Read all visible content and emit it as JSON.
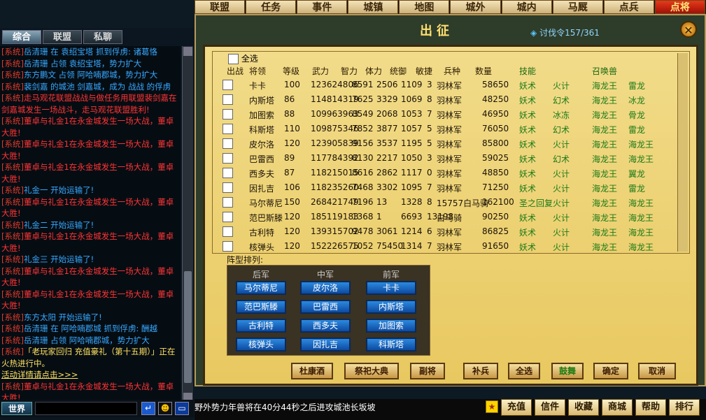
{
  "topnav": [
    "联盟",
    "任务",
    "事件",
    "城镇",
    "地图",
    "城外",
    "城内",
    "马厩",
    "点兵",
    "点将"
  ],
  "chat": {
    "tabs": [
      "综合",
      "联盟",
      "私聊"
    ],
    "messages": [
      {
        "tag": "[系统]",
        "text": "岳清珊 在 袁绍宝塔 抓到俘虏: 诸葛恪",
        "color": "blue"
      },
      {
        "tag": "[系统]",
        "text": "岳清珊 占领 袁绍宝塔，势力扩大",
        "color": "blue"
      },
      {
        "tag": "[系统]",
        "text": "东方鹏文 占领 阿哈喃郡城，势力扩大",
        "color": "blue"
      },
      {
        "tag": "[系统]",
        "text": "裴剑嘉 的城池 剑嘉城，成为 战战 的俘虏",
        "color": "blue"
      },
      {
        "tag": "[系统]",
        "text": "走马观花联盟战战与做任务用联盟裴剑嘉在剑嘉城发生一场战斗，走马观花联盟胜利!",
        "color": "red"
      },
      {
        "tag": "[系统]",
        "text": "董卓与礼金1在永金城发生一场大战，董卓大胜!",
        "color": "red"
      },
      {
        "tag": "[系统]",
        "text": "董卓与礼金1在永金城发生一场大战，董卓大胜!",
        "color": "red"
      },
      {
        "tag": "[系统]",
        "text": "董卓与礼金1在永金城发生一场大战，董卓大胜!",
        "color": "red"
      },
      {
        "tag": "[系统]",
        "text": "礼金一 开始运输了!",
        "color": "blue"
      },
      {
        "tag": "[系统]",
        "text": "董卓与礼金1在永金城发生一场大战，董卓大胜!",
        "color": "red"
      },
      {
        "tag": "[系统]",
        "text": "礼金二 开始运输了!",
        "color": "blue"
      },
      {
        "tag": "[系统]",
        "text": "董卓与礼金1在永金城发生一场大战，董卓大胜!",
        "color": "red"
      },
      {
        "tag": "[系统]",
        "text": "礼金三 开始运输了!",
        "color": "blue"
      },
      {
        "tag": "[系统]",
        "text": "董卓与礼金1在永金城发生一场大战，董卓大胜!",
        "color": "red"
      },
      {
        "tag": "[系统]",
        "text": "董卓与礼金1在永金城发生一场大战，董卓大胜!",
        "color": "red"
      },
      {
        "tag": "[系统]",
        "text": "东方太阳 开始运输了!",
        "color": "blue"
      },
      {
        "tag": "[系统]",
        "text": "岳清珊 在 阿哈喃郡城 抓到俘虏: 酬越",
        "color": "blue"
      },
      {
        "tag": "[系统]",
        "text": "岳清珊 占领 阿哈喃郡城，势力扩大",
        "color": "blue"
      },
      {
        "tag": "[系统]",
        "text": "「老玩家回归 充值豪礼（第十五期）」正在火热进行中。",
        "color": "yellow"
      },
      {
        "tag": "",
        "text": "活动详情请点击>>>",
        "color": "link"
      },
      {
        "tag": "[系统]",
        "text": "董卓与礼金1在永金城发生一场大战，董卓大胜!",
        "color": "red"
      }
    ],
    "channel": "世界",
    "input_value": ""
  },
  "panel": {
    "title": "出征",
    "token_label": "讨伐令157/361",
    "select_all": "全选",
    "headers": [
      "出战",
      "将领",
      "等级",
      "武力",
      "智力",
      "体力",
      "统御",
      "敏捷",
      "兵种",
      "数量",
      "技能",
      "召唤兽"
    ],
    "rows": [
      {
        "name": "卡卡",
        "level": "100",
        "str": "123624806",
        "int": "8591",
        "hp": "2506",
        "lead": "1109",
        "agi": "3",
        "unit": "羽林军",
        "count": "58650",
        "skill1": "妖术",
        "skill2": "火计",
        "beast1": "海龙王",
        "beast2": "雷龙"
      },
      {
        "name": "内斯塔",
        "level": "86",
        "str": "114814319",
        "int": "7625",
        "hp": "3329",
        "lead": "1069",
        "agi": "8",
        "unit": "羽林军",
        "count": "48250",
        "skill1": "妖术",
        "skill2": "幻术",
        "beast1": "海龙王",
        "beast2": "冰龙"
      },
      {
        "name": "加图索",
        "level": "88",
        "str": "109963963",
        "int": "8549",
        "hp": "2068",
        "lead": "1053",
        "agi": "7",
        "unit": "羽林军",
        "count": "46950",
        "skill1": "妖术",
        "skill2": "冰冻",
        "beast1": "海龙王",
        "beast2": "骨龙"
      },
      {
        "name": "科斯塔",
        "level": "110",
        "str": "109875346",
        "int": "7852",
        "hp": "3877",
        "lead": "1057",
        "agi": "5",
        "unit": "羽林军",
        "count": "76050",
        "skill1": "妖术",
        "skill2": "幻术",
        "beast1": "海龙王",
        "beast2": "雷龙"
      },
      {
        "name": "皮尔洛",
        "level": "120",
        "str": "123905839",
        "int": "9156",
        "hp": "3537",
        "lead": "1195",
        "agi": "5",
        "unit": "羽林军",
        "count": "85800",
        "skill1": "妖术",
        "skill2": "火计",
        "beast1": "海龙王",
        "beast2": "海龙王"
      },
      {
        "name": "巴雷西",
        "level": "89",
        "str": "117784392",
        "int": "8130",
        "hp": "2217",
        "lead": "1050",
        "agi": "3",
        "unit": "羽林军",
        "count": "59025",
        "skill1": "妖术",
        "skill2": "幻术",
        "beast1": "海龙王",
        "beast2": "海龙王"
      },
      {
        "name": "西多夫",
        "level": "87",
        "str": "118215015",
        "int": "8616",
        "hp": "2862",
        "lead": "1117",
        "agi": "0",
        "unit": "羽林军",
        "count": "48850",
        "skill1": "妖术",
        "skill2": "火计",
        "beast1": "海龙王",
        "beast2": "翼龙"
      },
      {
        "name": "因扎吉",
        "level": "106",
        "str": "118235260",
        "int": "7468",
        "hp": "3302",
        "lead": "1095",
        "agi": "7",
        "unit": "羽林军",
        "count": "71250",
        "skill1": "妖术",
        "skill2": "火计",
        "beast1": "海龙王",
        "beast2": "雷龙"
      },
      {
        "name": "马尔蒂尼",
        "level": "150",
        "str": "268421749",
        "int": "7196",
        "hp": "13",
        "lead": "1328",
        "agi": "8",
        "unit": "15757白马骑",
        "count": "162100",
        "skill1": "圣之回复",
        "skill2": "火计",
        "beast1": "海龙王",
        "beast2": "海龙王"
      },
      {
        "name": "范巴斯滕",
        "level": "120",
        "str": "185119183",
        "int": "1368",
        "hp": "1",
        "lead": "6693",
        "agi": "13198",
        "unit": "白马骑",
        "count": "90250",
        "skill1": "妖术",
        "skill2": "火计",
        "beast1": "海龙王",
        "beast2": "海龙王"
      },
      {
        "name": "古利特",
        "level": "120",
        "str": "139315702",
        "int": "9478",
        "hp": "3061",
        "lead": "1214",
        "agi": "6",
        "unit": "羽林军",
        "count": "86825",
        "skill1": "妖术",
        "skill2": "火计",
        "beast1": "海龙王",
        "beast2": "海龙王"
      },
      {
        "name": "核弹头",
        "level": "120",
        "str": "152226575",
        "int": "1052",
        "hp": "75450",
        "lead": "1314",
        "agi": "7",
        "unit": "羽林军",
        "count": "91650",
        "skill1": "妖术",
        "skill2": "火计",
        "beast1": "海龙王",
        "beast2": "海龙王"
      }
    ],
    "formation_title": "阵型排列:",
    "formation_headers": [
      "后军",
      "中军",
      "前军"
    ],
    "formation": [
      [
        "马尔蒂尼",
        "皮尔洛",
        "卡卡"
      ],
      [
        "范巴斯滕",
        "巴雷西",
        "内斯塔"
      ],
      [
        "古利特",
        "西多夫",
        "加图索"
      ],
      [
        "核弹头",
        "因扎吉",
        "科斯塔"
      ]
    ],
    "actions": [
      "杜康酒",
      "祭祀大典",
      "副将",
      "补兵",
      "全选",
      "鼓舞",
      "确定",
      "取消"
    ]
  },
  "bottombar": {
    "ticker": "野外势力年兽将在40分44秒之后进攻城池长坂坡",
    "menu": [
      "充值",
      "信件",
      "收藏",
      "商城",
      "帮助",
      "排行"
    ]
  }
}
